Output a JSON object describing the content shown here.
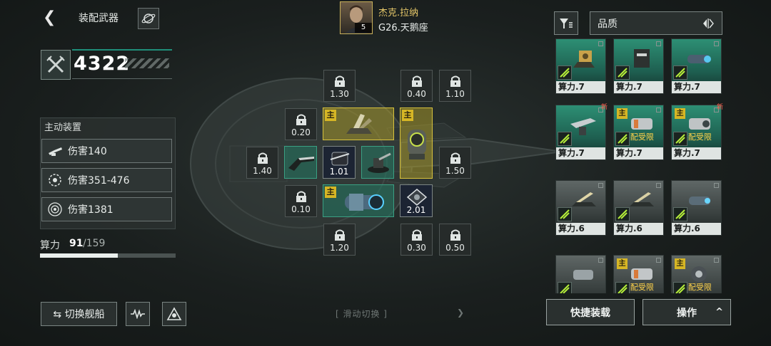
{
  "header": {
    "back_icon": "back-icon",
    "title": "装配武器",
    "planet_icon": "planet-icon"
  },
  "power": {
    "value": "4322",
    "emblem_icon": "crossed-swords-emblem"
  },
  "active_equipment": {
    "title": "主动装置",
    "items": [
      {
        "icon": "cannon-icon",
        "label": "伤害140"
      },
      {
        "icon": "gear-ring-icon",
        "label": "伤害351-476"
      },
      {
        "icon": "radial-burst-icon",
        "label": "伤害1381"
      }
    ]
  },
  "compute": {
    "label": "算力",
    "current": "91",
    "max": "/159",
    "fraction": 0.572
  },
  "bottom_left": {
    "switch_label": "⇆ 切换舰船",
    "icon_a": "wave-icon",
    "icon_b": "triangle-swirl-icon"
  },
  "commander": {
    "name": "杰克.拉纳",
    "ship": "G26.天鹅座",
    "level": "5"
  },
  "swipe_hint": "[ 滑动切换 ]",
  "slots": {
    "locked": [
      "1.30",
      "0.40",
      "1.10",
      "0.20",
      "1.40",
      "1.50",
      "0.10",
      "1.20",
      "0.30",
      "0.50"
    ],
    "equipped": [
      {
        "badge": "主",
        "value": ""
      },
      {
        "badge": "主",
        "value": ""
      },
      {
        "badge": "",
        "value": ""
      },
      {
        "badge": "",
        "value": "1.01"
      },
      {
        "badge": "",
        "value": ""
      },
      {
        "badge": "主",
        "value": ""
      },
      {
        "badge": "",
        "value": "2.01"
      }
    ]
  },
  "sort": {
    "selected": "品质",
    "filter_icon": "filter-icon",
    "sort_icon": "sort-toggle-icon"
  },
  "inventory": {
    "main_badge": "主",
    "new_badge": "新",
    "restricted": "装配受限",
    "cards": [
      {
        "label": "算力.7",
        "main": false,
        "new": false,
        "warn": false,
        "color": "teal"
      },
      {
        "label": "算力.7",
        "main": false,
        "new": false,
        "warn": false,
        "color": "teal"
      },
      {
        "label": "算力.7",
        "main": false,
        "new": false,
        "warn": false,
        "color": "teal"
      },
      {
        "label": "算力.7",
        "main": false,
        "new": true,
        "warn": false,
        "color": "teal"
      },
      {
        "label": "算力.7",
        "main": true,
        "new": false,
        "warn": true,
        "color": "teal"
      },
      {
        "label": "算力.7",
        "main": true,
        "new": true,
        "warn": true,
        "color": "teal"
      },
      {
        "label": "算力.6",
        "main": false,
        "new": false,
        "warn": false,
        "color": "gray"
      },
      {
        "label": "算力.6",
        "main": false,
        "new": false,
        "warn": false,
        "color": "gray"
      },
      {
        "label": "算力.6",
        "main": false,
        "new": false,
        "warn": false,
        "color": "gray"
      },
      {
        "label": "",
        "main": false,
        "new": false,
        "warn": false,
        "color": "gray"
      },
      {
        "label": "",
        "main": true,
        "new": false,
        "warn": true,
        "color": "gray"
      },
      {
        "label": "",
        "main": true,
        "new": false,
        "warn": true,
        "color": "gray"
      }
    ]
  },
  "buttons": {
    "quick": "快捷装载",
    "operate": "操作",
    "operate_chevron": "^"
  }
}
